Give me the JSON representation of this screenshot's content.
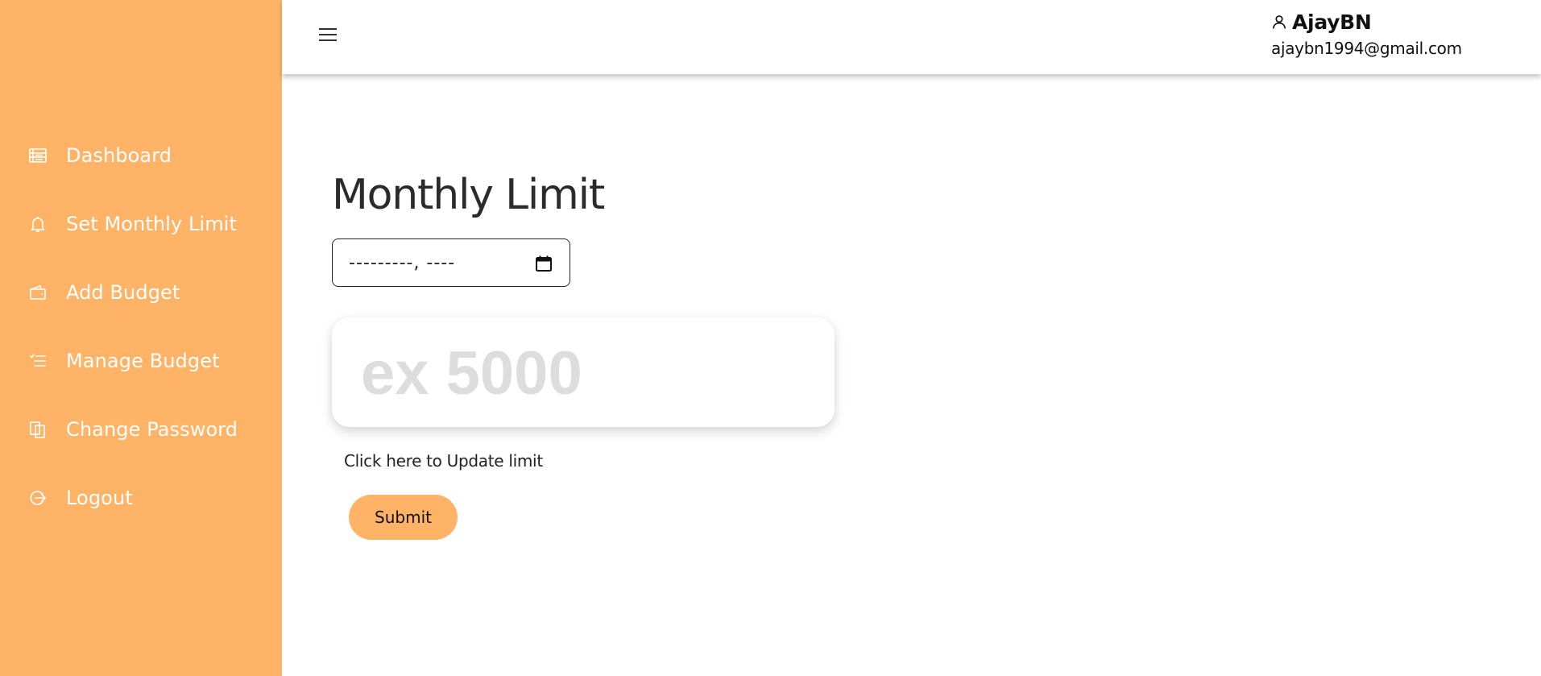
{
  "sidebar": {
    "items": [
      {
        "label": "Dashboard",
        "icon": "dashboard-icon"
      },
      {
        "label": "Set Monthly Limit",
        "icon": "bell-icon"
      },
      {
        "label": "Add Budget",
        "icon": "wallet-icon"
      },
      {
        "label": "Manage Budget",
        "icon": "list-check-icon"
      },
      {
        "label": "Change Password",
        "icon": "copy-icon"
      },
      {
        "label": "Logout",
        "icon": "logout-icon"
      }
    ]
  },
  "header": {
    "menu_icon": "hamburger-icon",
    "user": {
      "icon": "user-icon",
      "name": "AjayBN",
      "email": "ajaybn1994@gmail.com"
    }
  },
  "main": {
    "title": "Monthly Limit",
    "date_input": {
      "value": "---------, ----",
      "icon": "calendar-icon"
    },
    "amount_input": {
      "placeholder": "ex 5000",
      "value": ""
    },
    "hint": "Click here to Update limit",
    "submit_label": "Submit"
  },
  "colors": {
    "accent": "#ffb366",
    "sidebar_text": "#ffffff",
    "title_text": "#2b2b2b",
    "placeholder": "#dddddd"
  }
}
